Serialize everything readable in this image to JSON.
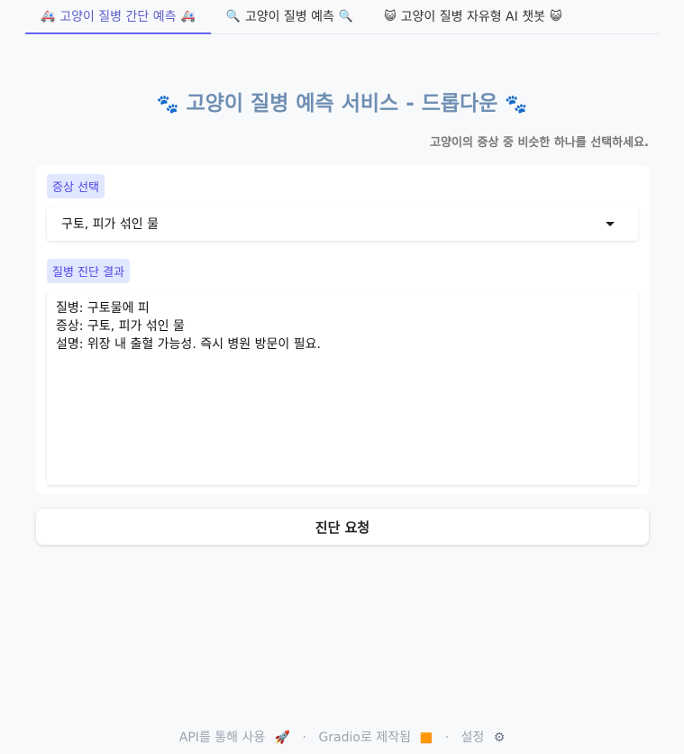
{
  "tabs": [
    {
      "label": "고양이 질병 간단 예측",
      "icon": "🚑",
      "active": true
    },
    {
      "label": "고양이 질병 예측",
      "icon": "🔍",
      "active": false
    },
    {
      "label": "고양이 질병 자유형 AI 챗봇",
      "icon": "😺",
      "active": false
    }
  ],
  "header": {
    "title": "고양이 질병 예측 서비스 - 드롭다운",
    "paw_icon": "🐾",
    "subtitle": "고양이의 증상 중 비슷한 하나를 선택하세요."
  },
  "symptom": {
    "label": "증상 선택",
    "selected": "구토, 피가 섞인 물"
  },
  "result": {
    "label": "질병 진단 결과",
    "lines": [
      "질병: 구토물에 피",
      "증상: 구토, 피가 섞인 물",
      "설명: 위장 내 출혈 가능성. 즉시 병원 방문이 필요."
    ]
  },
  "submit_label": "진단 요청",
  "footer": {
    "api": "API를 통해 사용",
    "api_icon": "🚀",
    "gradio": "Gradio로 제작됨",
    "gradio_icon": "🟧",
    "settings": "설정",
    "settings_icon": "⚙"
  }
}
